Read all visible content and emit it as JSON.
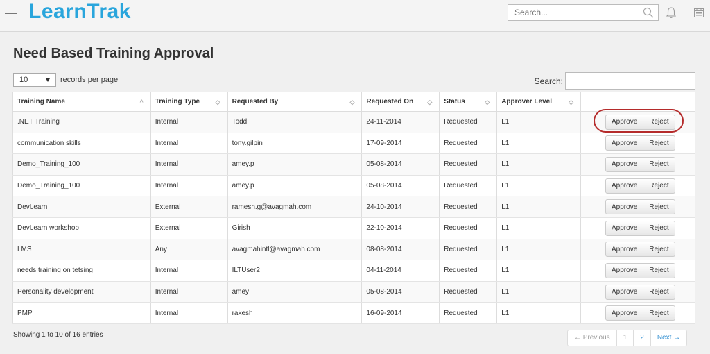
{
  "app": {
    "logo": "LearnTrak"
  },
  "header": {
    "search_placeholder": "Search..."
  },
  "page": {
    "title": "Need Based Training Approval"
  },
  "table_controls": {
    "length_value": "10",
    "length_label": "records per page",
    "search_label": "Search:",
    "search_value": ""
  },
  "table": {
    "columns": [
      "Training Name",
      "Training Type",
      "Requested By",
      "Requested On",
      "Status",
      "Approver Level",
      ""
    ],
    "rows": [
      {
        "name": ".NET Training",
        "type": "Internal",
        "by": "Todd",
        "on": "24-11-2014",
        "status": "Requested",
        "level": "L1"
      },
      {
        "name": "communication skills",
        "type": "Internal",
        "by": "tony.gilpin",
        "on": "17-09-2014",
        "status": "Requested",
        "level": "L1"
      },
      {
        "name": "Demo_Training_100",
        "type": "Internal",
        "by": "amey.p",
        "on": "05-08-2014",
        "status": "Requested",
        "level": "L1"
      },
      {
        "name": "Demo_Training_100",
        "type": "Internal",
        "by": "amey.p",
        "on": "05-08-2014",
        "status": "Requested",
        "level": "L1"
      },
      {
        "name": "DevLearn",
        "type": "External",
        "by": "ramesh.g@avagmah.com",
        "on": "24-10-2014",
        "status": "Requested",
        "level": "L1"
      },
      {
        "name": "DevLearn workshop",
        "type": "External",
        "by": "Girish",
        "on": "22-10-2014",
        "status": "Requested",
        "level": "L1"
      },
      {
        "name": "LMS",
        "type": "Any",
        "by": "avagmahintl@avagmah.com",
        "on": "08-08-2014",
        "status": "Requested",
        "level": "L1"
      },
      {
        "name": "needs training on tetsing",
        "type": "Internal",
        "by": "ILTUser2",
        "on": "04-11-2014",
        "status": "Requested",
        "level": "L1"
      },
      {
        "name": "Personality development",
        "type": "Internal",
        "by": "amey",
        "on": "05-08-2014",
        "status": "Requested",
        "level": "L1"
      },
      {
        "name": "PMP",
        "type": "Internal",
        "by": "rakesh",
        "on": "16-09-2014",
        "status": "Requested",
        "level": "L1"
      }
    ],
    "approve_label": "Approve",
    "reject_label": "Reject"
  },
  "footer": {
    "info": "Showing 1 to 10 of 16 entries",
    "prev": "← Previous",
    "pages": [
      "1",
      "2"
    ],
    "next": "Next →"
  },
  "colors": {
    "brand": "#29a5dc",
    "highlight": "#b52b2b",
    "link": "#2a8bd0"
  }
}
